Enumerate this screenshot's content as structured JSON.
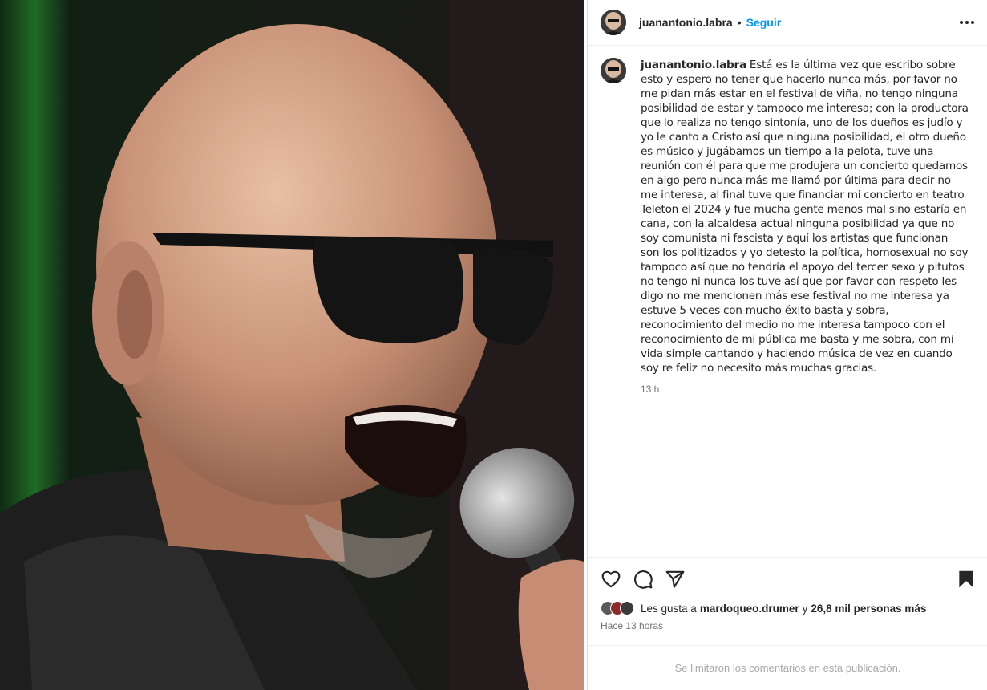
{
  "post": {
    "username": "juanantonio.labra",
    "dot": "•",
    "follow_label": "Seguir",
    "caption": "Está es la última vez que escribo sobre esto y espero no tener que hacerlo nunca más, por favor no me pidan más estar en el festival de viña, no tengo ninguna posibilidad de estar y tampoco me interesa; con la productora que lo realiza no tengo sintonía, uno de los dueños es judío y yo le canto a Cristo así que ninguna posibilidad, el otro dueño es músico y jugábamos un tiempo a la pelota, tuve una reunión con él para que me produjera un concierto quedamos en algo pero nunca más me llamó por última para decir no me interesa, al final tuve que financiar mi concierto en teatro Teleton el 2024 y fue mucha gente menos mal sino estaría en cana, con la alcaldesa actual ninguna posibilidad ya que no soy comunista ni fascista y aquí los artistas que funcionan son los politizados y yo detesto la política, homosexual no soy tampoco así que no tendría el apoyo del tercer sexo y pitutos no tengo ni nunca los tuve así que por favor con respeto les digo no me mencionen más ese festival no me interesa ya estuve 5 veces con mucho éxito basta y sobra, reconocimiento del medio no me interesa tampoco con el reconocimiento de mi pública me basta y me sobra, con mi vida simple cantando y haciendo música de vez en cuando soy re feliz no necesito más muchas gracias.",
    "caption_age": "13 h"
  },
  "likes": {
    "prefix": "Les gusta a",
    "liker": "mardoqueo.drumer",
    "joiner": "y",
    "others": "26,8 mil personas más"
  },
  "time_ago": "Hace 13 horas",
  "comments_notice": "Se limitaron los comentarios en esta publicación.",
  "icons": {
    "more": "more-horizontal-icon",
    "like": "heart-icon",
    "comment": "comment-icon",
    "share": "send-icon",
    "save": "bookmark-icon"
  },
  "colors": {
    "link": "#0095f6",
    "text": "#262626",
    "muted": "#737373",
    "disabled": "#a8a8a8"
  }
}
